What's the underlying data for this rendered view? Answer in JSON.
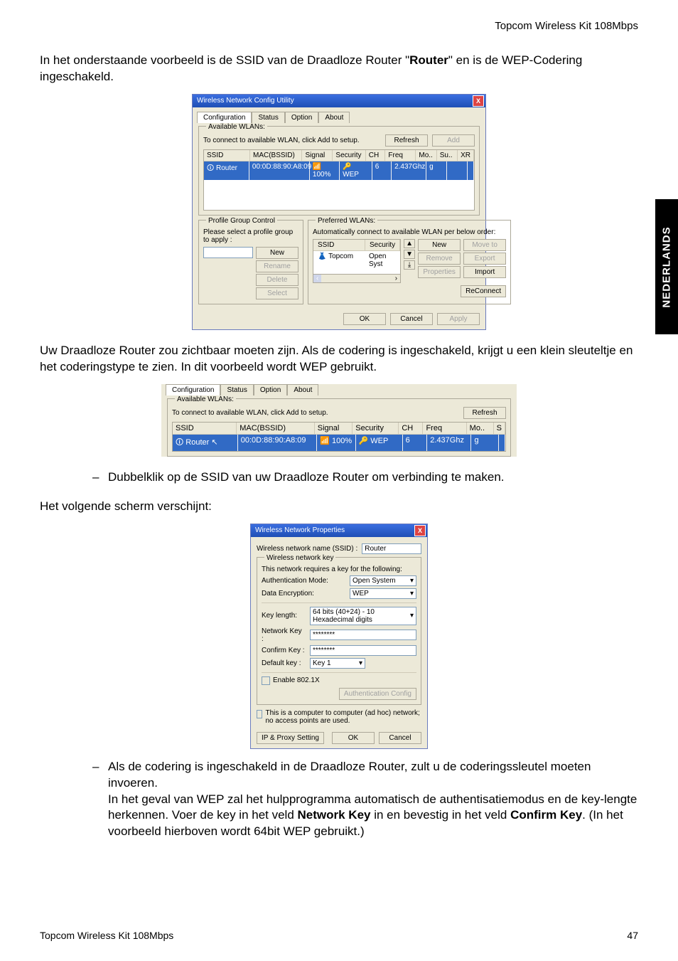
{
  "header": {
    "product": "Topcom Wireless Kit 108Mbps"
  },
  "side_tab": "NEDERLANDS",
  "intro": {
    "t1a": "In het onderstaande voorbeeld is de SSID van de Draadloze Router \"",
    "t1b": "Router",
    "t1c": "\" en is de WEP-Codering ingeschakeld."
  },
  "dlg1": {
    "title": "Wireless Network Config Utility",
    "close": "X",
    "tabs": [
      "Configuration",
      "Status",
      "Option",
      "About"
    ],
    "group_avail": "Available WLANs:",
    "avail_hint": "To connect to available WLAN, click Add to setup.",
    "btn_refresh": "Refresh",
    "btn_add": "Add",
    "cols": [
      "SSID",
      "MAC(BSSID)",
      "Signal",
      "Security",
      "CH",
      "Freq",
      "Mo..",
      "Su..",
      "XR"
    ],
    "row": {
      "ssid": "Router",
      "mac": "00:0D:88:90:A8:09",
      "signal": "100%",
      "security": "WEP",
      "ch": "6",
      "freq": "2.437Ghz",
      "mo": "g",
      "su": "",
      "xr": ""
    },
    "pgc_title": "Profile Group Control",
    "pgc_hint": "Please select a profile group to apply :",
    "pgc_btns": [
      "New",
      "Rename",
      "Delete",
      "Select"
    ],
    "pref_title": "Preferred WLANs:",
    "pref_hint": "Automatically connect to available WLAN per below order:",
    "pref_cols": [
      "SSID",
      "Security"
    ],
    "pref_row": {
      "ssid": "Topcom",
      "security": "Open Syst"
    },
    "pref_btns_l": [
      "New",
      "Remove",
      "Properties"
    ],
    "pref_btns_r": [
      "Move to",
      "Export",
      "Import"
    ],
    "pref_reconnect": "ReConnect",
    "footer_ok": "OK",
    "footer_cancel": "Cancel",
    "footer_apply": "Apply"
  },
  "p2": "Uw Draadloze Router zou zichtbaar moeten zijn. Als de codering is ingeschakeld, krijgt u een klein sleuteltje en het coderingstype te zien. In dit voorbeeld wordt WEP gebruikt.",
  "fig2": {
    "tabs": [
      "Configuration",
      "Status",
      "Option",
      "About"
    ],
    "group_avail": "Available WLANs:",
    "avail_hint": "To connect to available WLAN, click Add to setup.",
    "btn_refresh": "Refresh",
    "cols": [
      "SSID",
      "MAC(BSSID)",
      "Signal",
      "Security",
      "CH",
      "Freq",
      "Mo..",
      "S"
    ],
    "row": {
      "ssid": "Router",
      "mac": "00:0D:88:90:A8:09",
      "signal": "100%",
      "security": "WEP",
      "ch": "6",
      "freq": "2.437Ghz",
      "mo": "g",
      "s": ""
    }
  },
  "bullet1": "Dubbelklik op de SSID van uw Draadloze Router om verbinding te maken.",
  "p3": "Het volgende scherm verschijnt:",
  "dlg3": {
    "title": "Wireless Network Properties",
    "close": "X",
    "lbl_ssid": "Wireless network name (SSID) :",
    "ssid_value": "Router",
    "group_key": "Wireless network key",
    "key_hint": "This network requires a key for the following:",
    "lbl_auth": "Authentication Mode:",
    "auth_value": "Open System",
    "lbl_enc": "Data Encryption:",
    "enc_value": "WEP",
    "lbl_len": "Key length:",
    "len_value": "64 bits (40+24) - 10 Hexadecimal digits",
    "lbl_nk": "Network Key :",
    "nk_value": "********",
    "lbl_ck": "Confirm Key :",
    "ck_value": "********",
    "lbl_dk": "Default key :",
    "dk_value": "Key 1",
    "enable_1x": "Enable 802.1X",
    "btn_authcfg": "Authentication Config",
    "adhoc": "This is a computer to computer (ad hoc) network; no access points are used.",
    "btn_ipproxy": "IP & Proxy Setting",
    "btn_ok": "OK",
    "btn_cancel": "Cancel"
  },
  "bullet2": {
    "a": "Als de codering is ingeschakeld in de Draadloze Router, zult u de coderingssleutel moeten invoeren.",
    "b_pre": "In het geval van WEP zal het hulpprogramma automatisch de authentisatiemodus en de key-lengte herkennen. Voer de key in het veld ",
    "b_k1": "Network Key",
    "b_mid": " in en bevestig in het veld ",
    "b_k2": "Confirm Key",
    "b_post": ". (In het voorbeeld hierboven wordt 64bit WEP gebruikt.)"
  },
  "footer": {
    "product": "Topcom Wireless Kit 108Mbps",
    "page": "47"
  }
}
